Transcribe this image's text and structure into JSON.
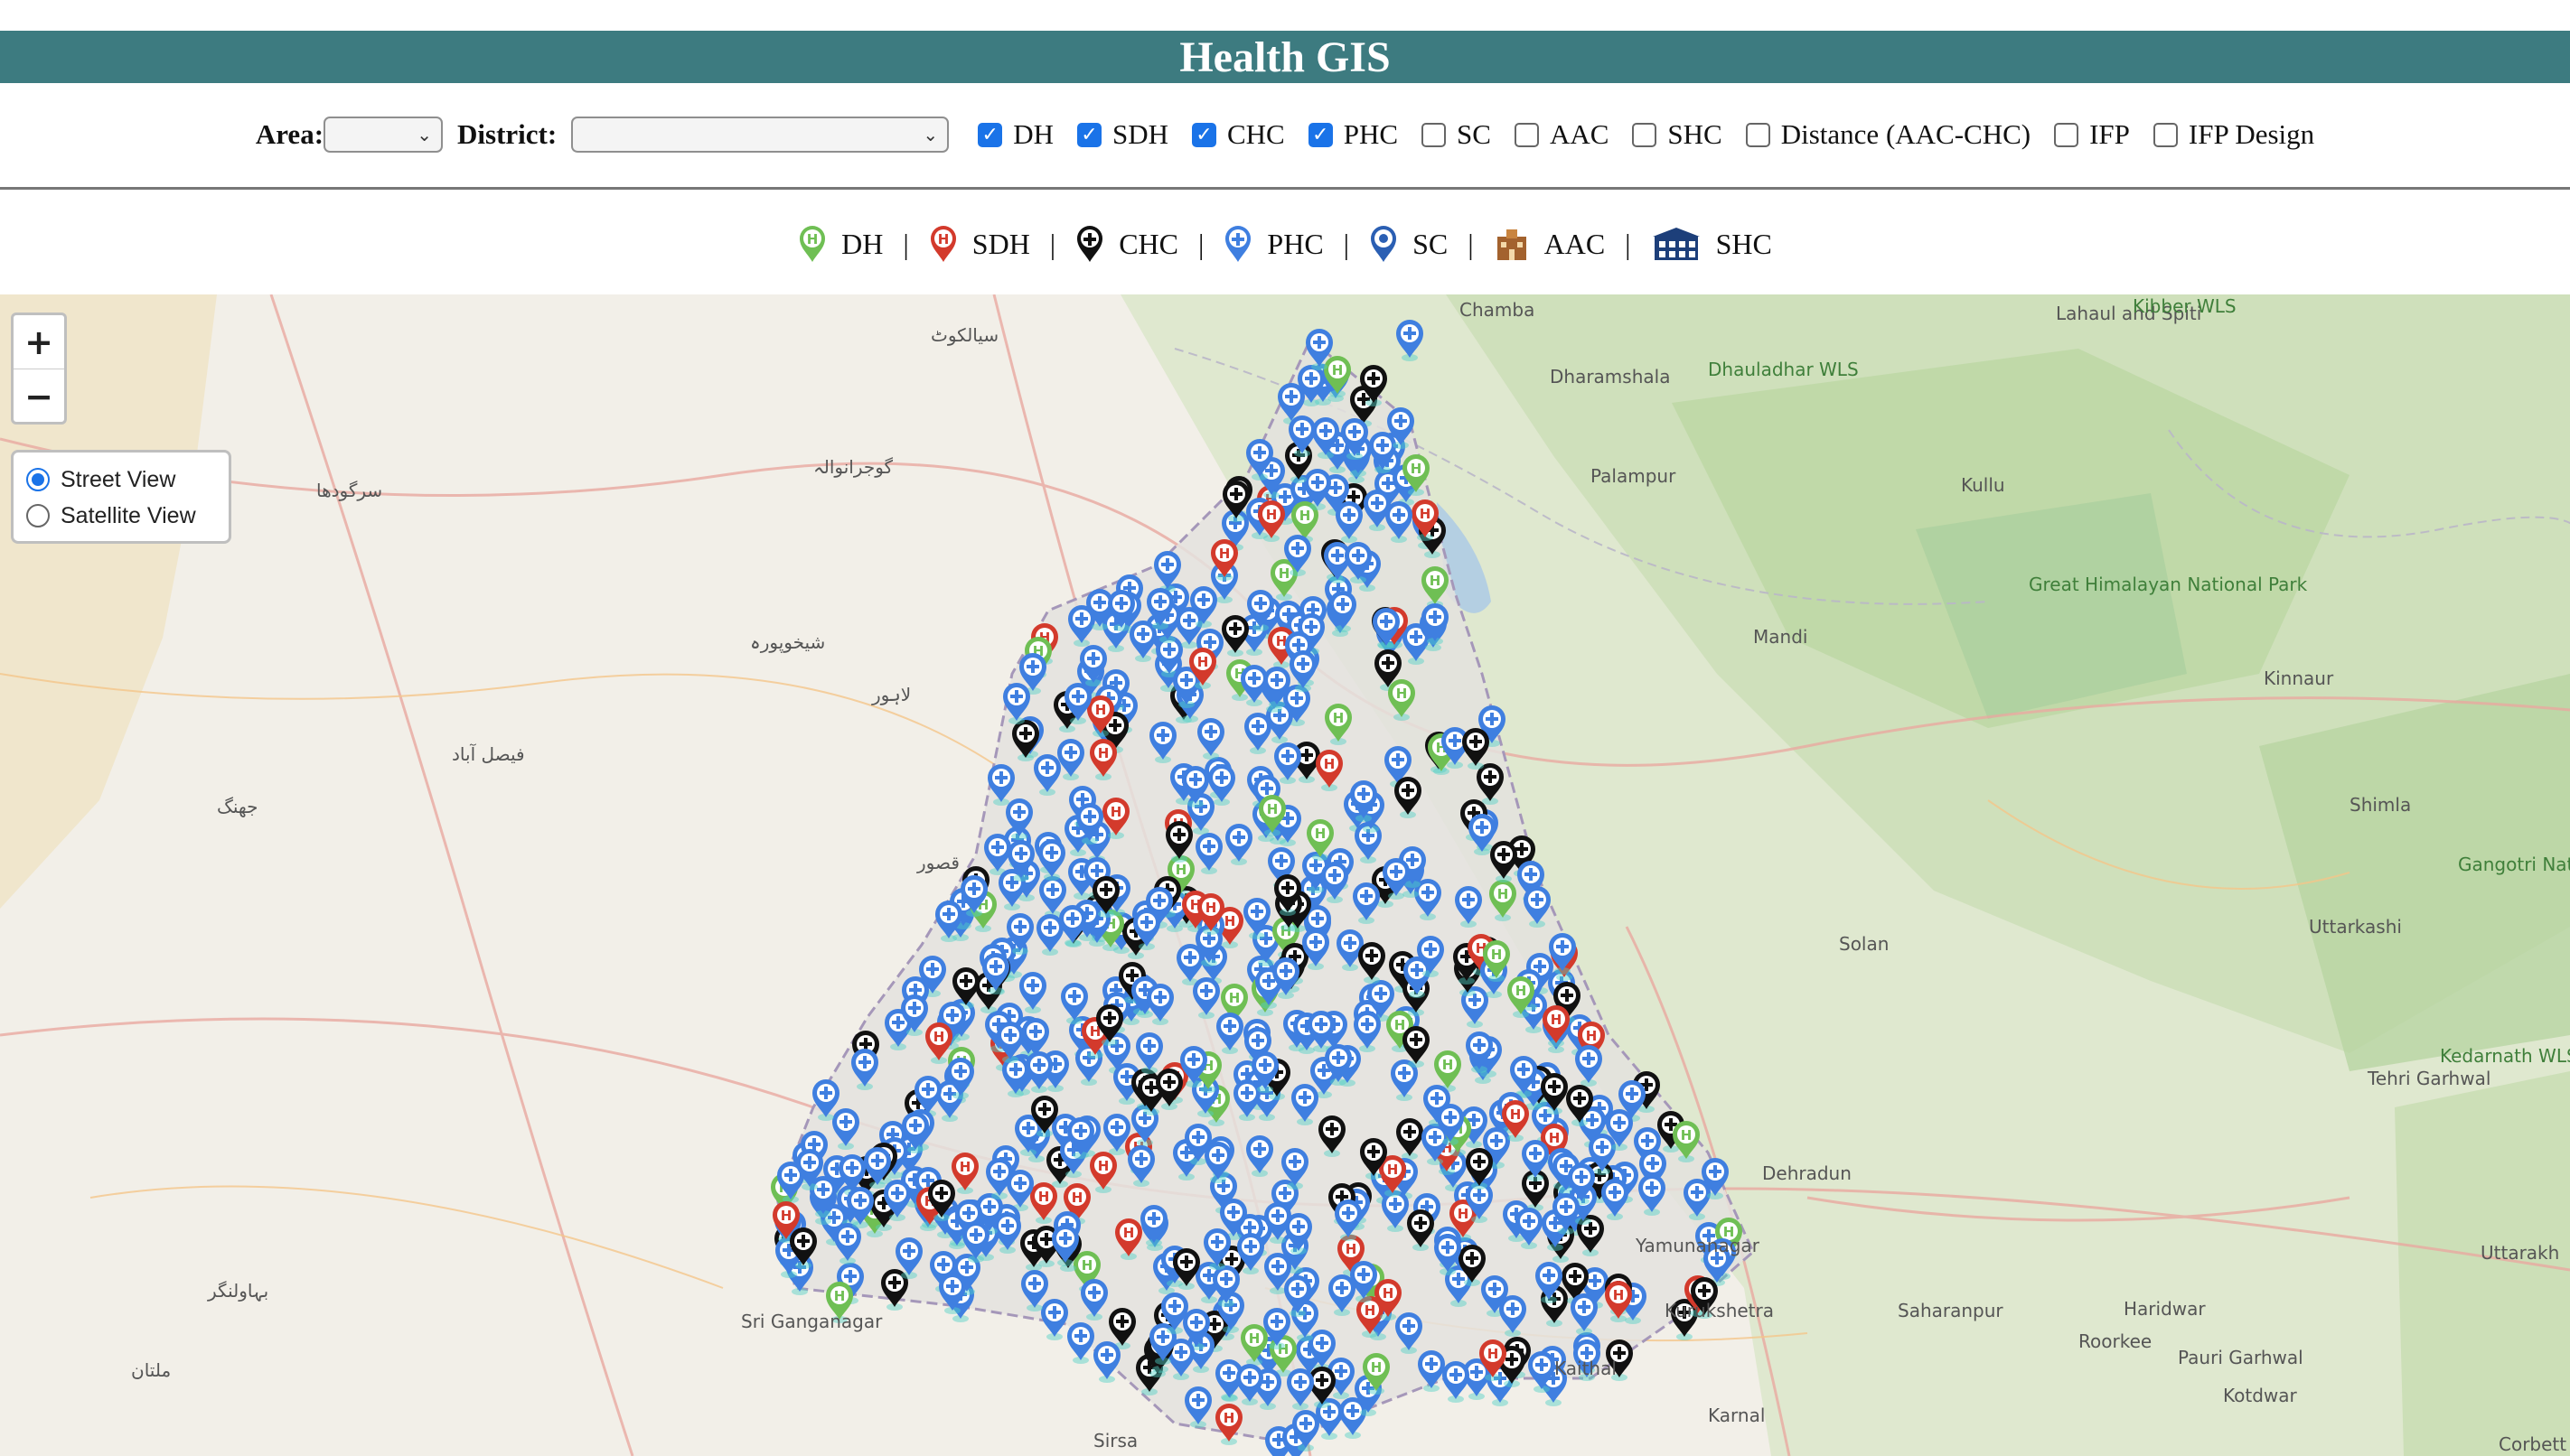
{
  "app_title": "Health GIS",
  "filters": {
    "area_label": "Area:",
    "area_value": "",
    "district_label": "District:",
    "district_value": "",
    "layers": [
      {
        "label": "DH",
        "checked": true
      },
      {
        "label": "SDH",
        "checked": true
      },
      {
        "label": "CHC",
        "checked": true
      },
      {
        "label": "PHC",
        "checked": true
      },
      {
        "label": "SC",
        "checked": false
      },
      {
        "label": "AAC",
        "checked": false
      },
      {
        "label": "SHC",
        "checked": false
      },
      {
        "label": "Distance (AAC-CHC)",
        "checked": false
      },
      {
        "label": "IFP",
        "checked": false
      },
      {
        "label": "IFP Design",
        "checked": false
      }
    ]
  },
  "legend": {
    "items": [
      {
        "label": "DH",
        "icon": "dh-marker-icon",
        "color": "#6fbf54"
      },
      {
        "label": "SDH",
        "icon": "sdh-marker-icon",
        "color": "#d33a2c"
      },
      {
        "label": "CHC",
        "icon": "chc-marker-icon",
        "color": "#111111"
      },
      {
        "label": "PHC",
        "icon": "phc-marker-icon",
        "color": "#3f7fe0"
      },
      {
        "label": "SC",
        "icon": "sc-marker-icon",
        "color": "#2b5fb3"
      },
      {
        "label": "AAC",
        "icon": "aac-building-icon",
        "color": "#a3622e"
      },
      {
        "label": "SHC",
        "icon": "shc-building-icon",
        "color": "#1d3f7a"
      }
    ],
    "separator": "|"
  },
  "map": {
    "zoom_in": "+",
    "zoom_out": "−",
    "view_options": [
      {
        "label": "Street View",
        "selected": true
      },
      {
        "label": "Satellite View",
        "selected": false
      }
    ],
    "place_labels": [
      "Chamba",
      "Lahaul and Spiti",
      "Kibber WLS",
      "Dharamshala",
      "Dhauladhar WLS",
      "Palampur",
      "Kullu",
      "Great Himalayan National Park",
      "Mandi",
      "Kinnaur",
      "Shimla",
      "Gangotri National Park",
      "Solan",
      "Uttarkashi",
      "Kedarnath WLS",
      "Tehri Garhwal",
      "Dehradun",
      "Yamunanagar",
      "Kurukshetra",
      "Saharanpur",
      "Haridwar",
      "Roorkee",
      "Pauri Garhwal",
      "Kotdwar",
      "Uttarakh",
      "Corbett",
      "Kaithal",
      "Karnal",
      "Sirsa",
      "Sri Ganganagar",
      "سیالکوٹ",
      "گوجرانوالہ",
      "لاہور",
      "فیصل آباد",
      "سرگودھا",
      "جھنگ",
      "شیخوپورہ",
      "قصور",
      "بہاولنگر",
      "ملتان"
    ],
    "marker_colors": {
      "dh": "#6fbf54",
      "sdh": "#d33a2c",
      "chc": "#111111",
      "phc": "#3f7fe0"
    }
  }
}
